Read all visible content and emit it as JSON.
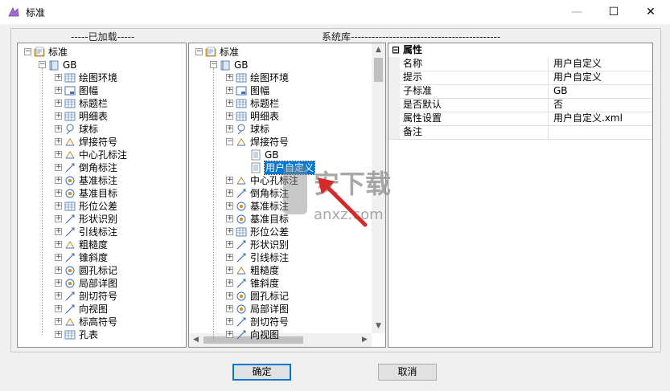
{
  "window": {
    "title": "标准",
    "minimize": "—",
    "maximize": "☐",
    "close": "✕"
  },
  "loaded": {
    "caption": "-----已加载-----",
    "root": "标准",
    "group": "GB",
    "items": [
      "绘图环境",
      "图幅",
      "标题栏",
      "明细表",
      "球标",
      "焊接符号",
      "中心孔标注",
      "倒角标注",
      "基准标注",
      "基准目标",
      "形位公差",
      "形状识别",
      "引线标注",
      "粗糙度",
      "锥斜度",
      "圆孔标记",
      "局部详图",
      "剖切符号",
      "向视图",
      "标高符号",
      "孔表"
    ]
  },
  "library": {
    "caption": "系统库-------------------------------------------",
    "root": "标准",
    "group": "GB",
    "items_before": [
      "绘图环境",
      "图幅",
      "标题栏",
      "明细表",
      "球标",
      "焊接符号"
    ],
    "weld_children": [
      "GB",
      "用户自定义"
    ],
    "items_after": [
      "中心孔标注",
      "倒角标注",
      "基准标注",
      "基准目标",
      "形位公差",
      "形状识别",
      "引线标注",
      "粗糙度",
      "锥斜度",
      "圆孔标记",
      "局部详图",
      "剖切符号",
      "向视图"
    ]
  },
  "properties": {
    "header": "属性",
    "collapse": "⊟",
    "rows": [
      {
        "key": "名称",
        "value": "用户自定义"
      },
      {
        "key": "提示",
        "value": "用户自定义"
      },
      {
        "key": "子标准",
        "value": "GB"
      },
      {
        "key": "是否默认",
        "value": "否"
      },
      {
        "key": "属性设置",
        "value": "用户自定义.xml"
      },
      {
        "key": "备注",
        "value": ""
      }
    ]
  },
  "buttons": {
    "ok": "确定",
    "cancel": "取消"
  },
  "watermark": {
    "text1": "安下载",
    "text2": "anxz.com"
  },
  "colors": {
    "selection": "#0078d7",
    "accent_red": "#d42a2a"
  }
}
